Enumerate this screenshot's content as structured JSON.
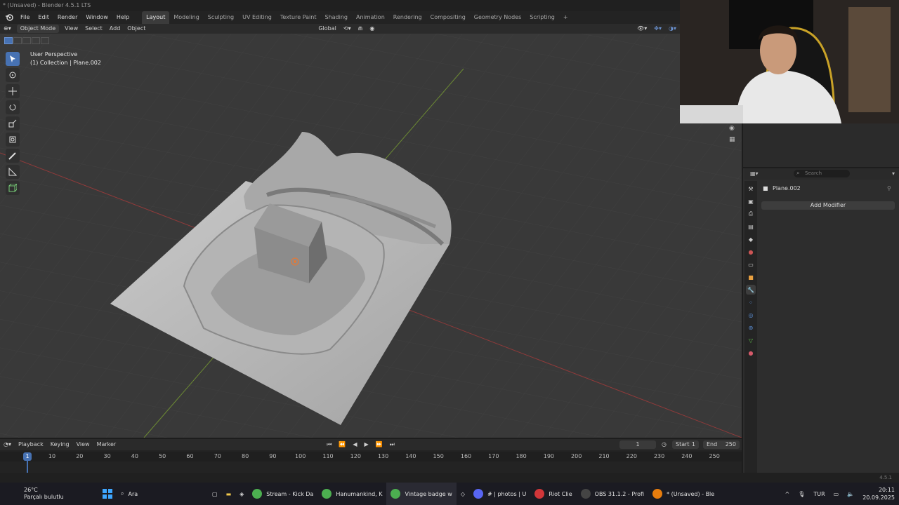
{
  "window": {
    "title": "* (Unsaved) - Blender 4.5.1 LTS"
  },
  "menu": [
    "File",
    "Edit",
    "Render",
    "Window",
    "Help"
  ],
  "workspaces": [
    "Layout",
    "Modeling",
    "Sculpting",
    "UV Editing",
    "Texture Paint",
    "Shading",
    "Animation",
    "Rendering",
    "Compositing",
    "Geometry Nodes",
    "Scripting",
    "+"
  ],
  "viewport_header": {
    "mode": "Object Mode",
    "menus": [
      "View",
      "Select",
      "Add",
      "Object"
    ],
    "orientation": "Global"
  },
  "viewport_info": {
    "perspective": "User Perspective",
    "collection": "(1) Collection | Plane.002"
  },
  "properties": {
    "search_placeholder": "Search",
    "object_name": "Plane.002",
    "add_modifier": "Add Modifier"
  },
  "timeline": {
    "menus": [
      "Playback",
      "Keying",
      "View",
      "Marker"
    ],
    "current_frame": "1",
    "start_label": "Start",
    "start": "1",
    "end_label": "End",
    "end": "250",
    "ruler": [
      "10",
      "20",
      "30",
      "40",
      "50",
      "60",
      "70",
      "80",
      "90",
      "100",
      "110",
      "120",
      "130",
      "140",
      "150",
      "160",
      "170",
      "180",
      "190",
      "200",
      "210",
      "220",
      "230",
      "240",
      "250"
    ],
    "playhead": "1"
  },
  "status": {
    "version": "4.5.1"
  },
  "taskbar": {
    "weather_temp": "26°C",
    "weather_desc": "Parçalı bulutlu",
    "search": "Ara",
    "apps": [
      "Stream - Kick Da",
      "Hanumankind, K",
      "Vintage badge w",
      "# | photos | U",
      "Riot Clie",
      "OBS 31.1.2 - Profi",
      "* (Unsaved) - Ble"
    ],
    "lang": "TUR",
    "time": "20:11",
    "date": "20.09.2025"
  },
  "colors": {
    "accent": "#4772b3",
    "x_axis": "#b34545",
    "y_axis": "#7fa33a"
  }
}
